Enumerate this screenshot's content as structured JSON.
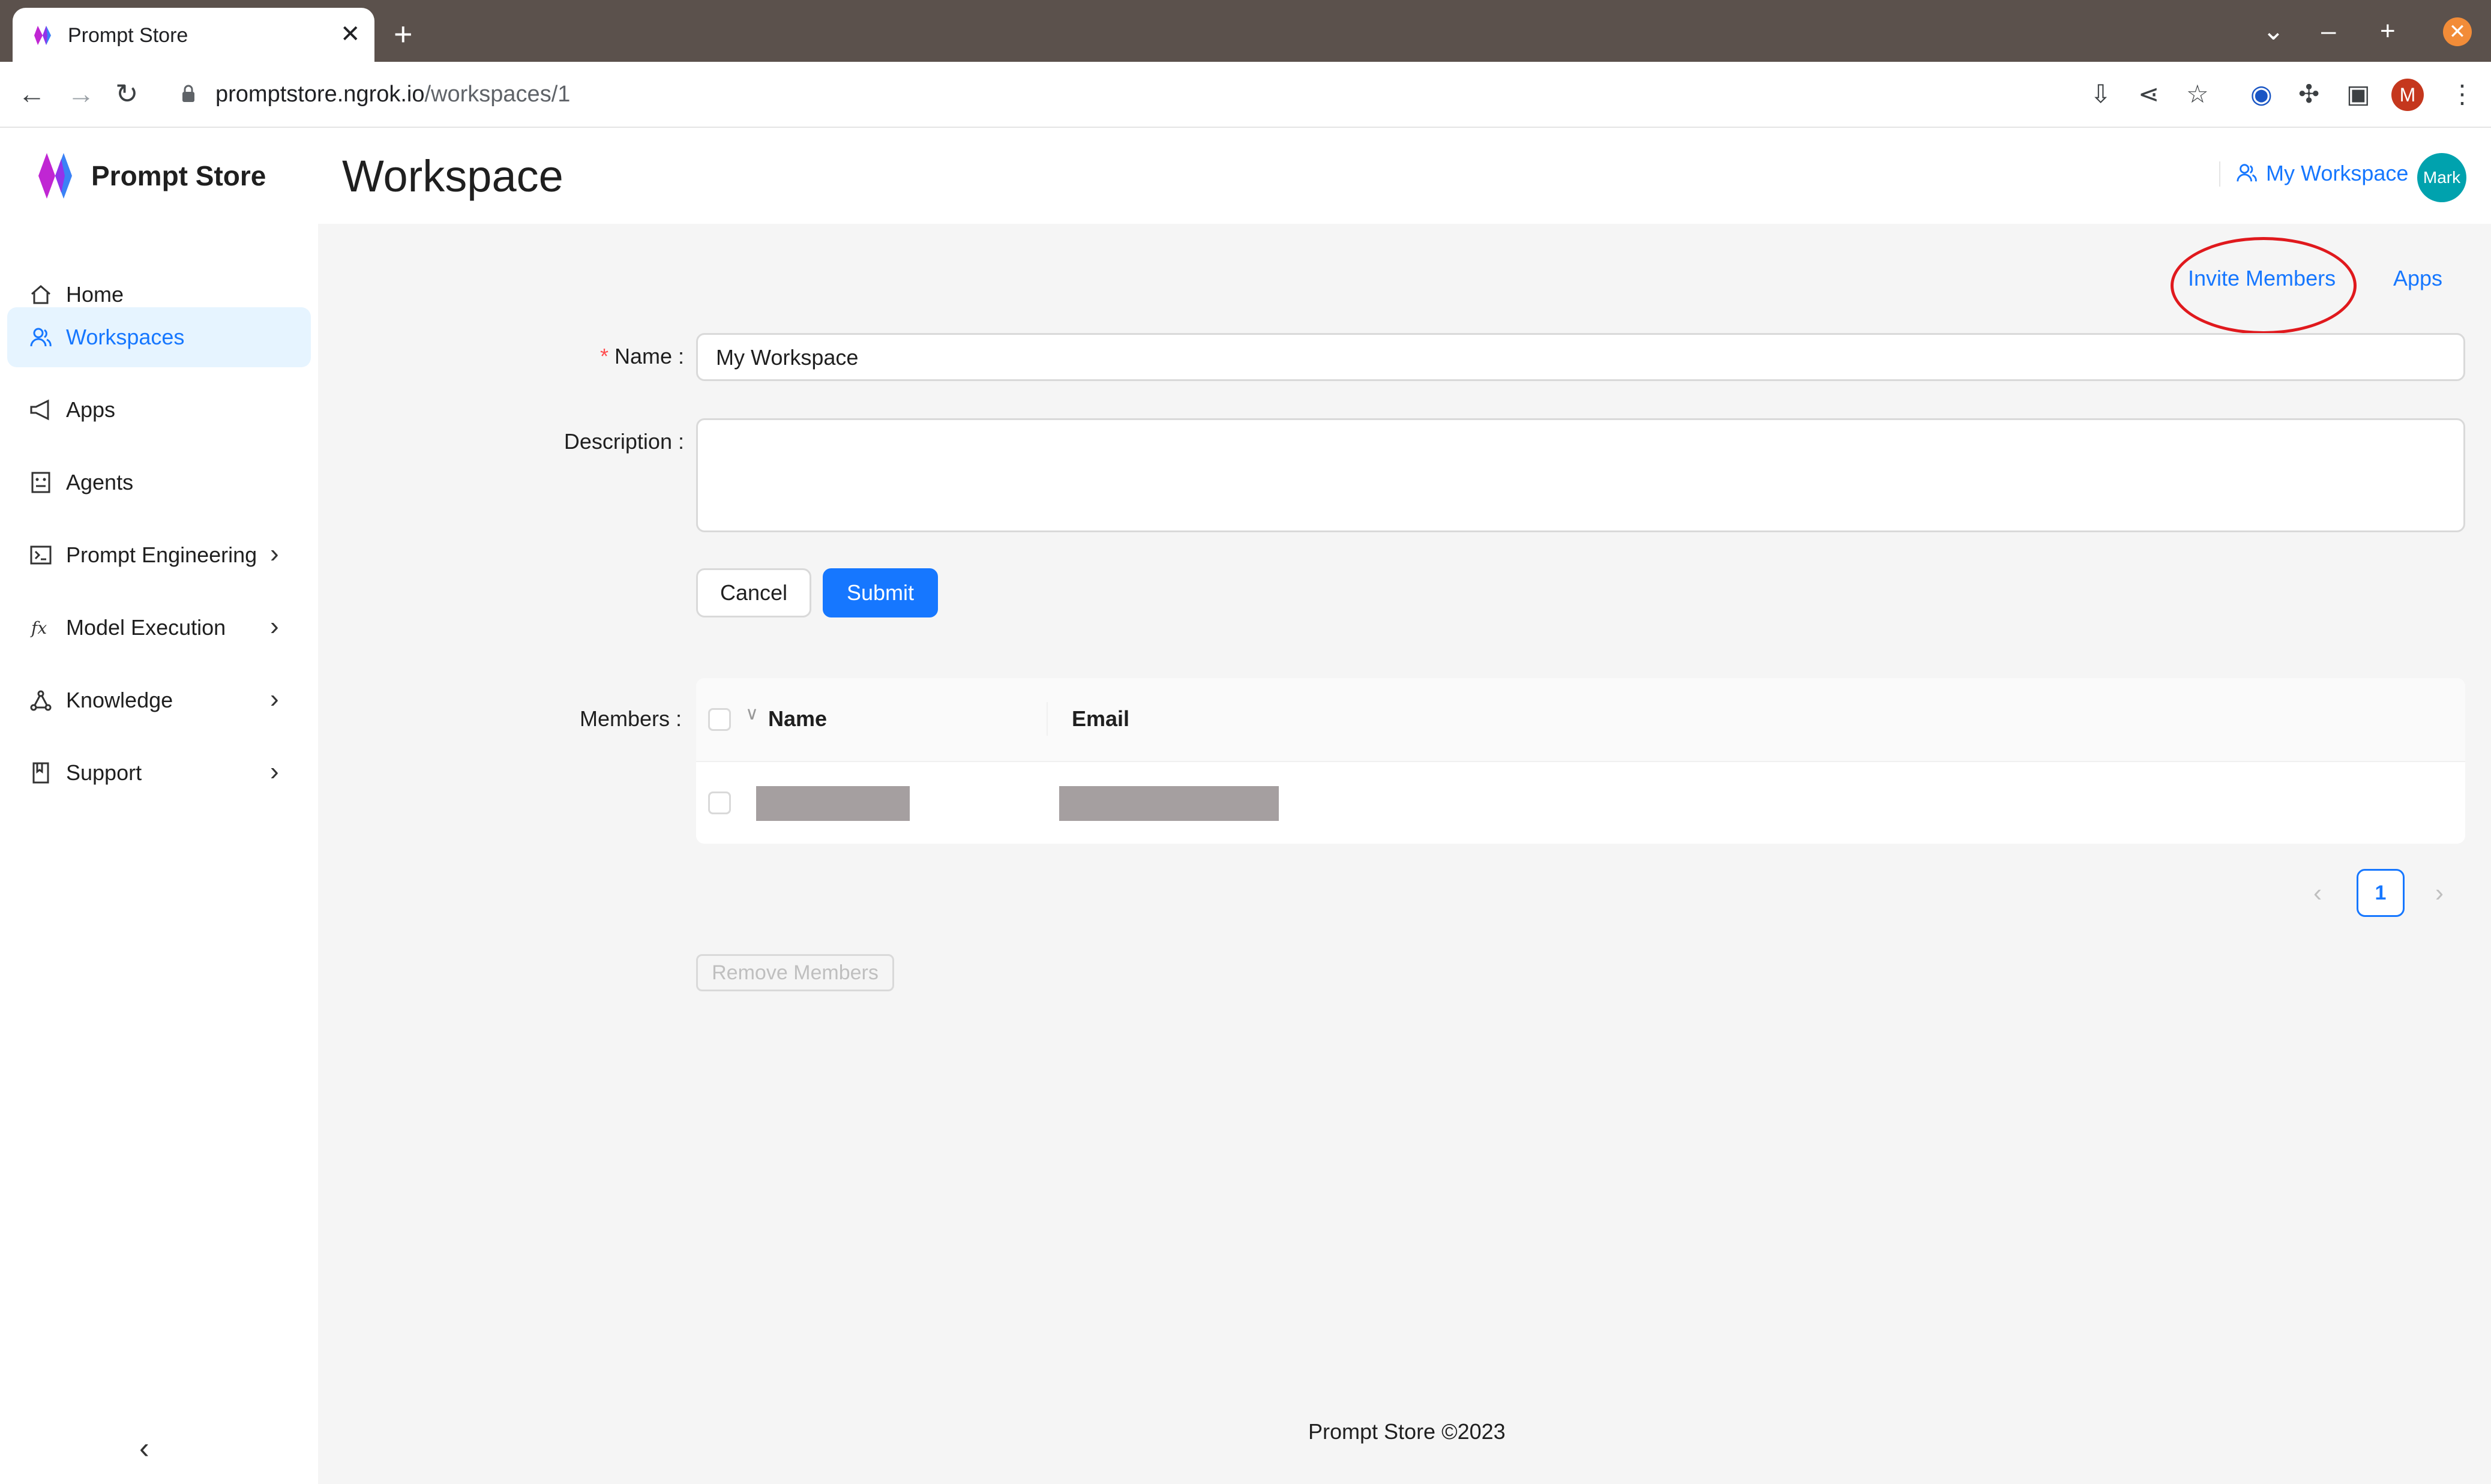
{
  "browser": {
    "tab_title": "Prompt Store",
    "url_host": "promptstore.ngrok.io",
    "url_path": "/workspaces/1",
    "profile_initial": "M"
  },
  "sidebar": {
    "brand": "Prompt Store",
    "items": [
      {
        "label": "Home",
        "icon": "home-icon"
      },
      {
        "label": "Workspaces",
        "icon": "team-icon",
        "active": true
      },
      {
        "label": "Apps",
        "icon": "megaphone-icon"
      },
      {
        "label": "Agents",
        "icon": "robot-icon"
      },
      {
        "label": "Prompt Engineering",
        "icon": "terminal-icon",
        "expandable": true
      },
      {
        "label": "Model Execution",
        "icon": "function-icon",
        "expandable": true
      },
      {
        "label": "Knowledge",
        "icon": "network-icon",
        "expandable": true
      },
      {
        "label": "Support",
        "icon": "book-icon",
        "expandable": true
      }
    ]
  },
  "header": {
    "title": "Workspace",
    "workspace": "My Workspace",
    "avatar": "Mark"
  },
  "actions": {
    "invite_members": "Invite Members",
    "apps": "Apps"
  },
  "form": {
    "name_label": "Name",
    "name_value": "My Workspace",
    "description_label": "Description",
    "description_value": "",
    "cancel": "Cancel",
    "submit": "Submit",
    "members_label": "Members"
  },
  "members_table": {
    "columns": [
      "Name",
      "Email"
    ],
    "rows_redacted": 1
  },
  "pagination": {
    "current_page": "1"
  },
  "remove_members": "Remove Members",
  "footer": "Prompt Store ©2023",
  "colors": {
    "accent": "#1677ff",
    "avatar": "#00a2ae",
    "highlight": "#e0191d"
  }
}
